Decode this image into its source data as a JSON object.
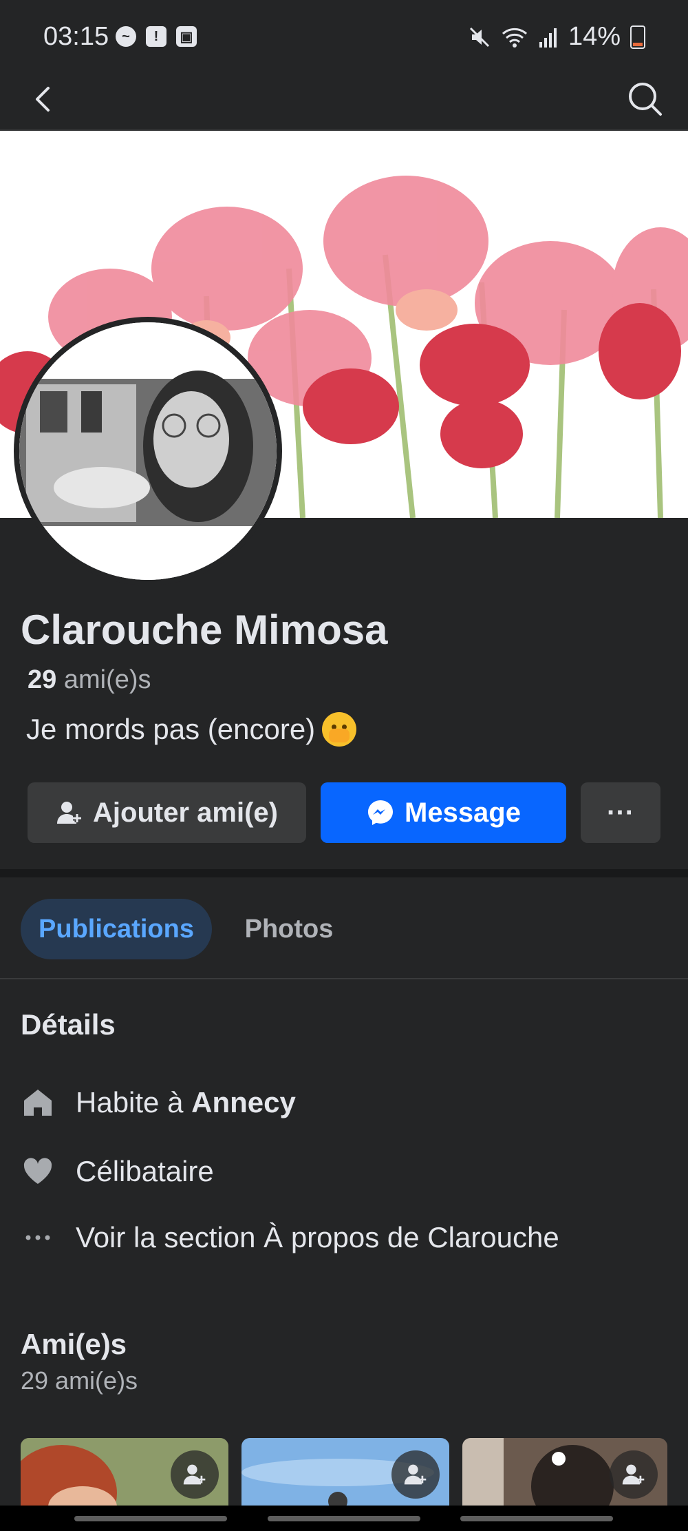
{
  "status": {
    "time": "03:15",
    "battery": "14%"
  },
  "profile": {
    "name": "Clarouche Mimosa",
    "friends_count": "29",
    "friends_label": "ami(e)s",
    "bio": "Je mords pas (encore)"
  },
  "actions": {
    "add_friend": "Ajouter ami(e)",
    "message": "Message",
    "more": "···"
  },
  "tabs": [
    {
      "label": "Publications",
      "active": true
    },
    {
      "label": "Photos",
      "active": false
    }
  ],
  "details": {
    "title": "Détails",
    "lives_prefix": "Habite à",
    "lives_city": "Annecy",
    "relationship": "Célibataire",
    "about_link": "Voir la section À propos de Clarouche"
  },
  "friends": {
    "title": "Ami(e)s",
    "count_text": "29 ami(e)s"
  },
  "icons": {
    "back": "back-arrow-icon",
    "search": "search-icon",
    "home": "home-icon",
    "heart": "heart-icon",
    "more": "more-dots-icon",
    "add_friend": "add-friend-icon",
    "messenger": "messenger-icon"
  },
  "colors": {
    "background": "#242526",
    "primary": "#0866ff",
    "tab_active_bg": "#263951",
    "tab_active_text": "#5aa7ff"
  }
}
